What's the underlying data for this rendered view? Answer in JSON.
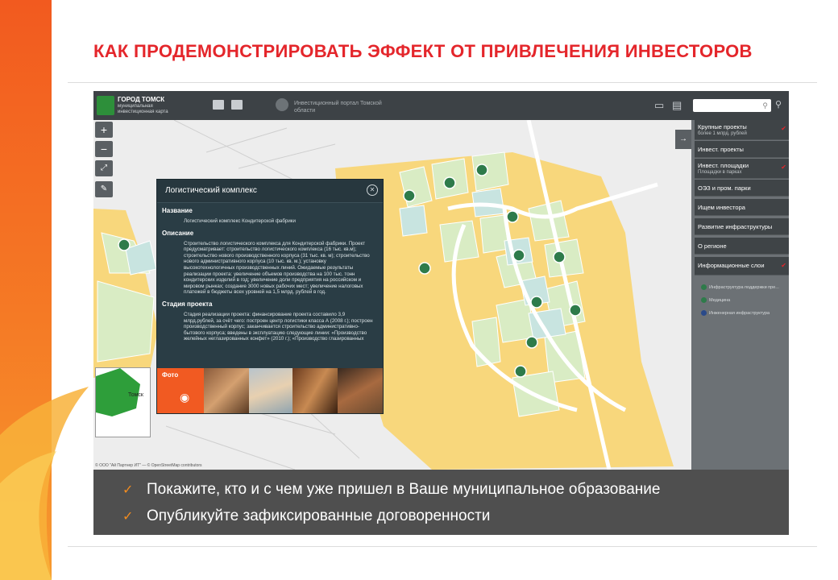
{
  "slide": {
    "title": "КАК ПРОДЕМОНСТРИРОВАТЬ ЭФФЕКТ ОТ ПРИВЛЕЧЕНИЯ ИНВЕСТОРОВ",
    "bullets": [
      "Покажите, кто и с чем уже пришел в Ваше муниципальное образование",
      "Опубликуйте зафиксированные  договоренности"
    ]
  },
  "app": {
    "city": "ГОРОД ТОМСК",
    "subtitle": "муниципальная инвестиционная карта",
    "portal": "Инвестиционный портал Томской области"
  },
  "popup": {
    "title": "Логистический комплекс",
    "sections": [
      {
        "heading": "Название",
        "text": "Логистический комплекс Кондитерской фабрики"
      },
      {
        "heading": "Описание",
        "text": "Строительство логистического комплекса для Кондитерской фабрики. Проект предусматривает: строительство логистического комплекса (16 тыс. кв.м); строительство нового производственного корпуса (31 тыс. кв. м); строительство нового административного корпуса (10 тыс. кв. м.); установку высокотехнологичных производственных линий. Ожидаемые результаты реализации проекта: увеличение объемов производства на 100 тыс. тонн кондитерских изделий в год; увеличение доли предприятия на российском и мировом рынках; создание 3000 новых рабочих мест; увеличение налоговых платежей в бюджеты всех уровней на 1,5 млрд. рублей в год."
      },
      {
        "heading": "Стадия проекта",
        "text": "Стадия реализации проекта: финансирование проекта составило 3,9 млрд.рублей, за счёт чего: построен центр логистики класса А (2008 г.); построен производственный корпус; заканчивается строительство административно-бытового корпуса; введены в эксплуатацию следующие линии: «Производство желейных неглазированных конфет» (2010 г.); «Производство глазированных"
      }
    ],
    "foto_label": "Фото"
  },
  "sidebar": {
    "items": [
      {
        "label": "Крупные проекты",
        "sub": "более 1 млрд. рублей",
        "checked": true
      },
      {
        "label": "Инвест. проекты",
        "sub": "",
        "checked": false
      },
      {
        "label": "Инвест. площадки",
        "sub": "Площадки в парках",
        "checked": true
      },
      {
        "label": "ОЭЗ и пром. парки",
        "sub": "",
        "checked": false
      },
      {
        "label": "Ищем инвестора",
        "sub": "",
        "checked": false
      },
      {
        "label": "Развитие инфраструктуры",
        "sub": "",
        "checked": false
      },
      {
        "label": "О регионе",
        "sub": "",
        "checked": false
      },
      {
        "label": "Информационные слои",
        "sub": "",
        "checked": true
      }
    ],
    "layers": [
      "Инфраструктура поддержки пре...",
      "Медицина",
      "Инженерная инфраструктура"
    ]
  },
  "minimap": {
    "label": "Томск"
  },
  "attribution": "© ООО \"Ай Партнер ИТ\" — © OpenStreetMap contributors",
  "colors": {
    "accent": "#e4262b",
    "orange": "#f15a22",
    "marker": "#2e7b4a"
  }
}
